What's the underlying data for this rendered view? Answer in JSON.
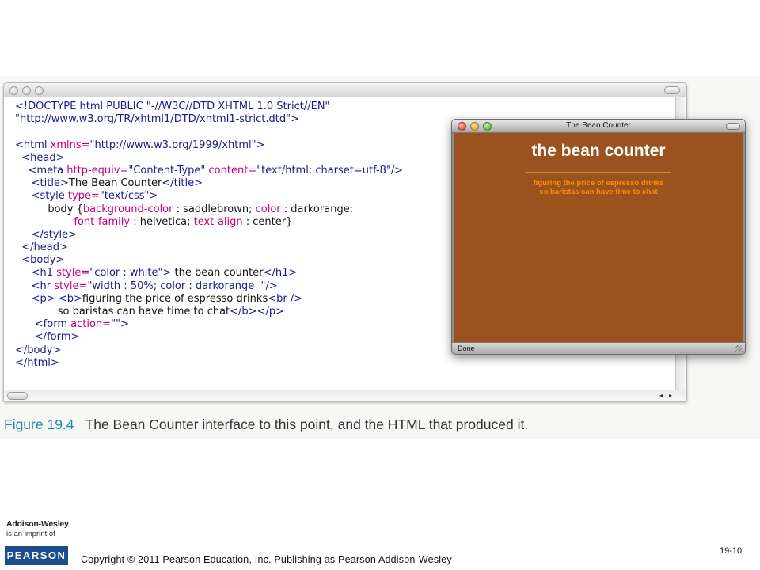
{
  "code_lines": [
    [
      {
        "c": "tg",
        "t": "<!DOCTYPE html PUBLIC \"-//W3C//DTD XHTML 1.0 Strict//EN\""
      }
    ],
    [
      {
        "c": "tg",
        "t": "\"http://www.w3.org/TR/xhtml1/DTD/xhtml1-strict.dtd\">"
      }
    ],
    [],
    [
      {
        "c": "tg",
        "t": "<html "
      },
      {
        "c": "at",
        "t": "xmlns="
      },
      {
        "c": "vl",
        "t": "\"http://www.w3.org/1999/xhtml\">"
      }
    ],
    [
      {
        "c": "tg",
        "t": "  <head>"
      }
    ],
    [
      {
        "c": "tg",
        "t": "    <meta "
      },
      {
        "c": "at",
        "t": "http-equiv="
      },
      {
        "c": "vl",
        "t": "\"Content-Type\" "
      },
      {
        "c": "at",
        "t": "content="
      },
      {
        "c": "vl",
        "t": "\"text/html; charset=utf-8\"/>"
      }
    ],
    [
      {
        "c": "tg",
        "t": "     <title>"
      },
      {
        "c": "tx",
        "t": "The Bean Counter"
      },
      {
        "c": "tg",
        "t": "</title>"
      }
    ],
    [
      {
        "c": "tg",
        "t": "     <style "
      },
      {
        "c": "at",
        "t": "type="
      },
      {
        "c": "vl",
        "t": "\"text/css\">"
      }
    ],
    [
      {
        "c": "tx",
        "t": "          body {"
      },
      {
        "c": "at",
        "t": "background-color "
      },
      {
        "c": "tx",
        "t": ": saddlebrown; "
      },
      {
        "c": "at",
        "t": "color "
      },
      {
        "c": "tx",
        "t": ": darkorange;"
      }
    ],
    [
      {
        "c": "at",
        "t": "                  font-family "
      },
      {
        "c": "tx",
        "t": ": helvetica; "
      },
      {
        "c": "at",
        "t": "text-align "
      },
      {
        "c": "tx",
        "t": ": center}"
      }
    ],
    [
      {
        "c": "tg",
        "t": "     </style>"
      }
    ],
    [
      {
        "c": "tg",
        "t": "  </head>"
      }
    ],
    [
      {
        "c": "tg",
        "t": "  <body>"
      }
    ],
    [
      {
        "c": "tg",
        "t": "     <h1 "
      },
      {
        "c": "at",
        "t": "style="
      },
      {
        "c": "vl",
        "t": "\"color : white\"> "
      },
      {
        "c": "tx",
        "t": "the bean counter"
      },
      {
        "c": "tg",
        "t": "</h1>"
      }
    ],
    [
      {
        "c": "tg",
        "t": "     <hr "
      },
      {
        "c": "at",
        "t": "style="
      },
      {
        "c": "vl",
        "t": "\"width : 50%; color : darkorange  \"/>"
      }
    ],
    [
      {
        "c": "tg",
        "t": "     <p> <b>"
      },
      {
        "c": "tx",
        "t": "figuring the price of espresso drinks"
      },
      {
        "c": "tg",
        "t": "<br />"
      }
    ],
    [
      {
        "c": "tx",
        "t": "             so baristas can have time to chat"
      },
      {
        "c": "tg",
        "t": "</b></p>"
      }
    ],
    [
      {
        "c": "tg",
        "t": "      <form "
      },
      {
        "c": "at",
        "t": "action="
      },
      {
        "c": "vl",
        "t": "\"\">"
      }
    ],
    [
      {
        "c": "tg",
        "t": "      </form>"
      }
    ],
    [
      {
        "c": "tg",
        "t": "</body>"
      }
    ],
    [
      {
        "c": "tg",
        "t": "</html>"
      }
    ]
  ],
  "browser": {
    "title": "The Bean Counter",
    "heading": "the bean counter",
    "para_line1": "figuring the price of espresso drinks",
    "para_line2": "so baristas can have time to chat",
    "status": "Done",
    "page_bg": "#9a531f"
  },
  "caption": {
    "figure": "Figure 19.4",
    "text": "The Bean Counter interface to this point, and the HTML that produced it."
  },
  "footer": {
    "publisher": "Addison-Wesley",
    "imprint": "is an imprint of",
    "brand": "PEARSON",
    "copyright": "Copyright © 2011 Pearson Education, Inc. Publishing as Pearson Addison-Wesley",
    "page_number": "19-10"
  }
}
